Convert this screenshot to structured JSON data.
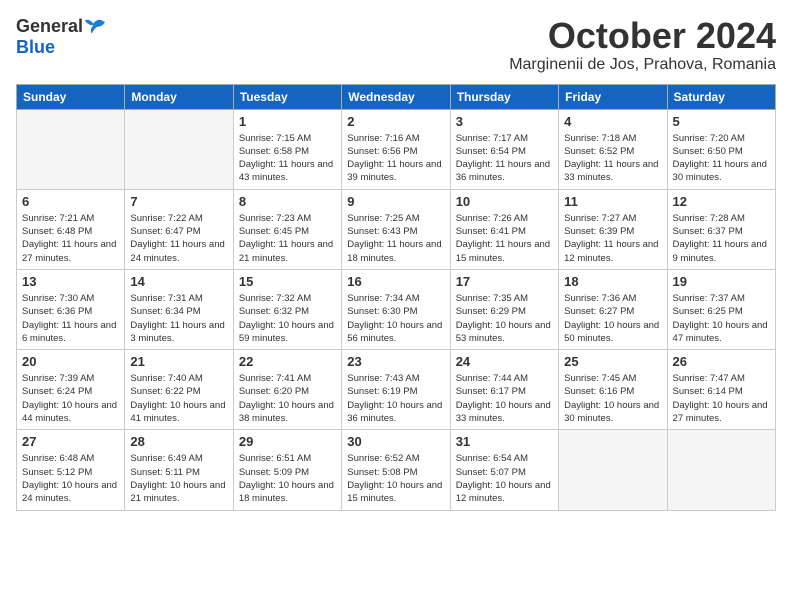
{
  "header": {
    "logo_general": "General",
    "logo_blue": "Blue",
    "month": "October 2024",
    "location": "Marginenii de Jos, Prahova, Romania"
  },
  "weekdays": [
    "Sunday",
    "Monday",
    "Tuesday",
    "Wednesday",
    "Thursday",
    "Friday",
    "Saturday"
  ],
  "weeks": [
    [
      {
        "day": "",
        "empty": true
      },
      {
        "day": "",
        "empty": true
      },
      {
        "day": "1",
        "sunrise": "Sunrise: 7:15 AM",
        "sunset": "Sunset: 6:58 PM",
        "daylight": "Daylight: 11 hours and 43 minutes."
      },
      {
        "day": "2",
        "sunrise": "Sunrise: 7:16 AM",
        "sunset": "Sunset: 6:56 PM",
        "daylight": "Daylight: 11 hours and 39 minutes."
      },
      {
        "day": "3",
        "sunrise": "Sunrise: 7:17 AM",
        "sunset": "Sunset: 6:54 PM",
        "daylight": "Daylight: 11 hours and 36 minutes."
      },
      {
        "day": "4",
        "sunrise": "Sunrise: 7:18 AM",
        "sunset": "Sunset: 6:52 PM",
        "daylight": "Daylight: 11 hours and 33 minutes."
      },
      {
        "day": "5",
        "sunrise": "Sunrise: 7:20 AM",
        "sunset": "Sunset: 6:50 PM",
        "daylight": "Daylight: 11 hours and 30 minutes."
      }
    ],
    [
      {
        "day": "6",
        "sunrise": "Sunrise: 7:21 AM",
        "sunset": "Sunset: 6:48 PM",
        "daylight": "Daylight: 11 hours and 27 minutes."
      },
      {
        "day": "7",
        "sunrise": "Sunrise: 7:22 AM",
        "sunset": "Sunset: 6:47 PM",
        "daylight": "Daylight: 11 hours and 24 minutes."
      },
      {
        "day": "8",
        "sunrise": "Sunrise: 7:23 AM",
        "sunset": "Sunset: 6:45 PM",
        "daylight": "Daylight: 11 hours and 21 minutes."
      },
      {
        "day": "9",
        "sunrise": "Sunrise: 7:25 AM",
        "sunset": "Sunset: 6:43 PM",
        "daylight": "Daylight: 11 hours and 18 minutes."
      },
      {
        "day": "10",
        "sunrise": "Sunrise: 7:26 AM",
        "sunset": "Sunset: 6:41 PM",
        "daylight": "Daylight: 11 hours and 15 minutes."
      },
      {
        "day": "11",
        "sunrise": "Sunrise: 7:27 AM",
        "sunset": "Sunset: 6:39 PM",
        "daylight": "Daylight: 11 hours and 12 minutes."
      },
      {
        "day": "12",
        "sunrise": "Sunrise: 7:28 AM",
        "sunset": "Sunset: 6:37 PM",
        "daylight": "Daylight: 11 hours and 9 minutes."
      }
    ],
    [
      {
        "day": "13",
        "sunrise": "Sunrise: 7:30 AM",
        "sunset": "Sunset: 6:36 PM",
        "daylight": "Daylight: 11 hours and 6 minutes."
      },
      {
        "day": "14",
        "sunrise": "Sunrise: 7:31 AM",
        "sunset": "Sunset: 6:34 PM",
        "daylight": "Daylight: 11 hours and 3 minutes."
      },
      {
        "day": "15",
        "sunrise": "Sunrise: 7:32 AM",
        "sunset": "Sunset: 6:32 PM",
        "daylight": "Daylight: 10 hours and 59 minutes."
      },
      {
        "day": "16",
        "sunrise": "Sunrise: 7:34 AM",
        "sunset": "Sunset: 6:30 PM",
        "daylight": "Daylight: 10 hours and 56 minutes."
      },
      {
        "day": "17",
        "sunrise": "Sunrise: 7:35 AM",
        "sunset": "Sunset: 6:29 PM",
        "daylight": "Daylight: 10 hours and 53 minutes."
      },
      {
        "day": "18",
        "sunrise": "Sunrise: 7:36 AM",
        "sunset": "Sunset: 6:27 PM",
        "daylight": "Daylight: 10 hours and 50 minutes."
      },
      {
        "day": "19",
        "sunrise": "Sunrise: 7:37 AM",
        "sunset": "Sunset: 6:25 PM",
        "daylight": "Daylight: 10 hours and 47 minutes."
      }
    ],
    [
      {
        "day": "20",
        "sunrise": "Sunrise: 7:39 AM",
        "sunset": "Sunset: 6:24 PM",
        "daylight": "Daylight: 10 hours and 44 minutes."
      },
      {
        "day": "21",
        "sunrise": "Sunrise: 7:40 AM",
        "sunset": "Sunset: 6:22 PM",
        "daylight": "Daylight: 10 hours and 41 minutes."
      },
      {
        "day": "22",
        "sunrise": "Sunrise: 7:41 AM",
        "sunset": "Sunset: 6:20 PM",
        "daylight": "Daylight: 10 hours and 38 minutes."
      },
      {
        "day": "23",
        "sunrise": "Sunrise: 7:43 AM",
        "sunset": "Sunset: 6:19 PM",
        "daylight": "Daylight: 10 hours and 36 minutes."
      },
      {
        "day": "24",
        "sunrise": "Sunrise: 7:44 AM",
        "sunset": "Sunset: 6:17 PM",
        "daylight": "Daylight: 10 hours and 33 minutes."
      },
      {
        "day": "25",
        "sunrise": "Sunrise: 7:45 AM",
        "sunset": "Sunset: 6:16 PM",
        "daylight": "Daylight: 10 hours and 30 minutes."
      },
      {
        "day": "26",
        "sunrise": "Sunrise: 7:47 AM",
        "sunset": "Sunset: 6:14 PM",
        "daylight": "Daylight: 10 hours and 27 minutes."
      }
    ],
    [
      {
        "day": "27",
        "sunrise": "Sunrise: 6:48 AM",
        "sunset": "Sunset: 5:12 PM",
        "daylight": "Daylight: 10 hours and 24 minutes."
      },
      {
        "day": "28",
        "sunrise": "Sunrise: 6:49 AM",
        "sunset": "Sunset: 5:11 PM",
        "daylight": "Daylight: 10 hours and 21 minutes."
      },
      {
        "day": "29",
        "sunrise": "Sunrise: 6:51 AM",
        "sunset": "Sunset: 5:09 PM",
        "daylight": "Daylight: 10 hours and 18 minutes."
      },
      {
        "day": "30",
        "sunrise": "Sunrise: 6:52 AM",
        "sunset": "Sunset: 5:08 PM",
        "daylight": "Daylight: 10 hours and 15 minutes."
      },
      {
        "day": "31",
        "sunrise": "Sunrise: 6:54 AM",
        "sunset": "Sunset: 5:07 PM",
        "daylight": "Daylight: 10 hours and 12 minutes."
      },
      {
        "day": "",
        "empty": true
      },
      {
        "day": "",
        "empty": true
      }
    ]
  ]
}
